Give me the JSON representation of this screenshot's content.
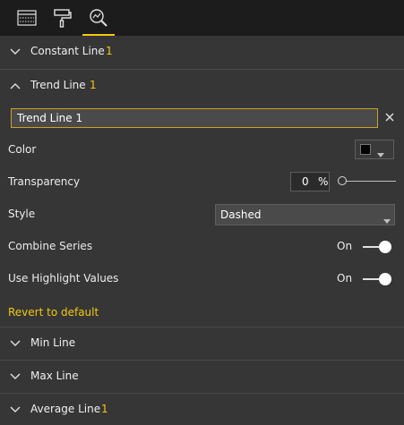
{
  "colors": {
    "accent": "#f2c811",
    "panel": "#363636",
    "topbar": "#1c1c1c"
  },
  "tabs": [
    {
      "icon": "fields-table-icon"
    },
    {
      "icon": "format-paint-roller-icon"
    },
    {
      "icon": "analytics-magnifier-icon",
      "selected": true
    }
  ],
  "sections": {
    "constant_line": {
      "title": "Constant Line",
      "count": "1",
      "expanded": false
    },
    "trend_line": {
      "title": "Trend Line",
      "count": "1",
      "expanded": true
    },
    "min_line": {
      "title": "Min Line",
      "expanded": false
    },
    "max_line": {
      "title": "Max Line",
      "expanded": false
    },
    "average_line": {
      "title": "Average Line",
      "count": "1",
      "expanded": false
    }
  },
  "trend_line": {
    "name_value": "Trend Line 1",
    "color_label": "Color",
    "color_value": "#000000",
    "transparency_label": "Transparency",
    "transparency_value": "0",
    "transparency_unit": "%",
    "style_label": "Style",
    "style_value": "Dashed",
    "combine_label": "Combine Series",
    "combine_state": "On",
    "highlight_label": "Use Highlight Values",
    "highlight_state": "On",
    "revert_label": "Revert to default"
  }
}
